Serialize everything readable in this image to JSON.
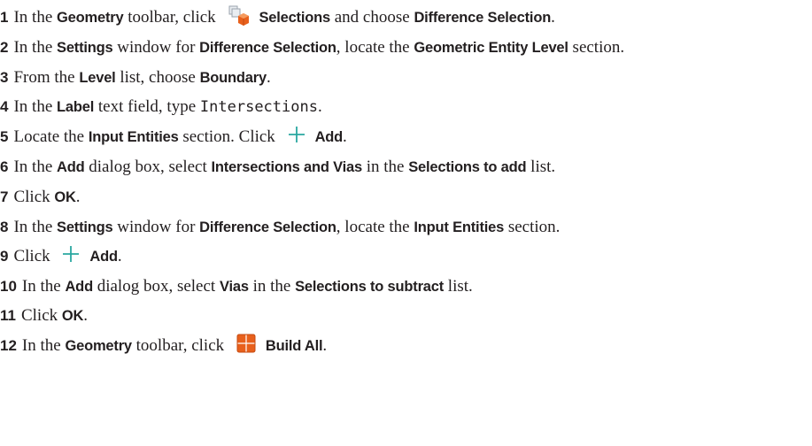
{
  "steps": [
    {
      "num": "1",
      "parts": [
        {
          "t": "text",
          "v": "In the "
        },
        {
          "t": "bold",
          "v": "Geometry"
        },
        {
          "t": "text",
          "v": " toolbar, click "
        },
        {
          "t": "icon",
          "icon": "selections-icon"
        },
        {
          "t": "bold",
          "v": "Selections"
        },
        {
          "t": "text",
          "v": " and choose "
        },
        {
          "t": "bold",
          "v": "Difference Selection"
        },
        {
          "t": "text",
          "v": "."
        }
      ]
    },
    {
      "num": "2",
      "parts": [
        {
          "t": "text",
          "v": "In the "
        },
        {
          "t": "bold",
          "v": "Settings"
        },
        {
          "t": "text",
          "v": " window for "
        },
        {
          "t": "bold",
          "v": "Difference Selection"
        },
        {
          "t": "text",
          "v": ", locate the "
        },
        {
          "t": "bold",
          "v": "Geometric Entity Level"
        },
        {
          "t": "text",
          "v": " section."
        }
      ]
    },
    {
      "num": "3",
      "parts": [
        {
          "t": "text",
          "v": "From the "
        },
        {
          "t": "bold",
          "v": "Level"
        },
        {
          "t": "text",
          "v": " list, choose "
        },
        {
          "t": "bold",
          "v": "Boundary"
        },
        {
          "t": "text",
          "v": "."
        }
      ]
    },
    {
      "num": "4",
      "parts": [
        {
          "t": "text",
          "v": "In the "
        },
        {
          "t": "bold",
          "v": "Label"
        },
        {
          "t": "text",
          "v": " text field, type "
        },
        {
          "t": "mono",
          "v": "Intersections"
        },
        {
          "t": "text",
          "v": "."
        }
      ]
    },
    {
      "num": "5",
      "parts": [
        {
          "t": "text",
          "v": "Locate the "
        },
        {
          "t": "bold",
          "v": "Input Entities"
        },
        {
          "t": "text",
          "v": " section. Click "
        },
        {
          "t": "icon",
          "icon": "plus-icon"
        },
        {
          "t": "bold",
          "v": "Add"
        },
        {
          "t": "text",
          "v": "."
        }
      ]
    },
    {
      "num": "6",
      "parts": [
        {
          "t": "text",
          "v": "In the "
        },
        {
          "t": "bold",
          "v": "Add"
        },
        {
          "t": "text",
          "v": " dialog box, select "
        },
        {
          "t": "bold",
          "v": "Intersections and Vias"
        },
        {
          "t": "text",
          "v": " in the "
        },
        {
          "t": "bold",
          "v": "Selections to add"
        },
        {
          "t": "text",
          "v": " list."
        }
      ]
    },
    {
      "num": "7",
      "parts": [
        {
          "t": "text",
          "v": "Click "
        },
        {
          "t": "bold",
          "v": "OK"
        },
        {
          "t": "text",
          "v": "."
        }
      ]
    },
    {
      "num": "8",
      "parts": [
        {
          "t": "text",
          "v": "In the "
        },
        {
          "t": "bold",
          "v": "Settings"
        },
        {
          "t": "text",
          "v": " window for "
        },
        {
          "t": "bold",
          "v": "Difference Selection"
        },
        {
          "t": "text",
          "v": ", locate the "
        },
        {
          "t": "bold",
          "v": "Input Entities"
        },
        {
          "t": "text",
          "v": " section."
        }
      ]
    },
    {
      "num": "9",
      "parts": [
        {
          "t": "text",
          "v": "Click "
        },
        {
          "t": "icon",
          "icon": "plus-icon"
        },
        {
          "t": "bold",
          "v": "Add"
        },
        {
          "t": "text",
          "v": "."
        }
      ]
    },
    {
      "num": "10",
      "parts": [
        {
          "t": "text",
          "v": "In the "
        },
        {
          "t": "bold",
          "v": "Add"
        },
        {
          "t": "text",
          "v": " dialog box, select "
        },
        {
          "t": "bold",
          "v": "Vias"
        },
        {
          "t": "text",
          "v": " in the "
        },
        {
          "t": "bold",
          "v": "Selections to subtract"
        },
        {
          "t": "text",
          "v": " list."
        }
      ]
    },
    {
      "num": "11",
      "parts": [
        {
          "t": "text",
          "v": "Click "
        },
        {
          "t": "bold",
          "v": "OK"
        },
        {
          "t": "text",
          "v": "."
        }
      ]
    },
    {
      "num": "12",
      "parts": [
        {
          "t": "text",
          "v": "In the "
        },
        {
          "t": "bold",
          "v": "Geometry"
        },
        {
          "t": "text",
          "v": " toolbar, click "
        },
        {
          "t": "icon",
          "icon": "build-all-icon"
        },
        {
          "t": "bold",
          "v": "Build All"
        },
        {
          "t": "text",
          "v": "."
        }
      ]
    }
  ],
  "colors": {
    "text": "#231f20",
    "plus_icon": "#2aa7a0",
    "build_all_icon": "#e8601c",
    "selections_icon_cube": "#e8601c"
  }
}
